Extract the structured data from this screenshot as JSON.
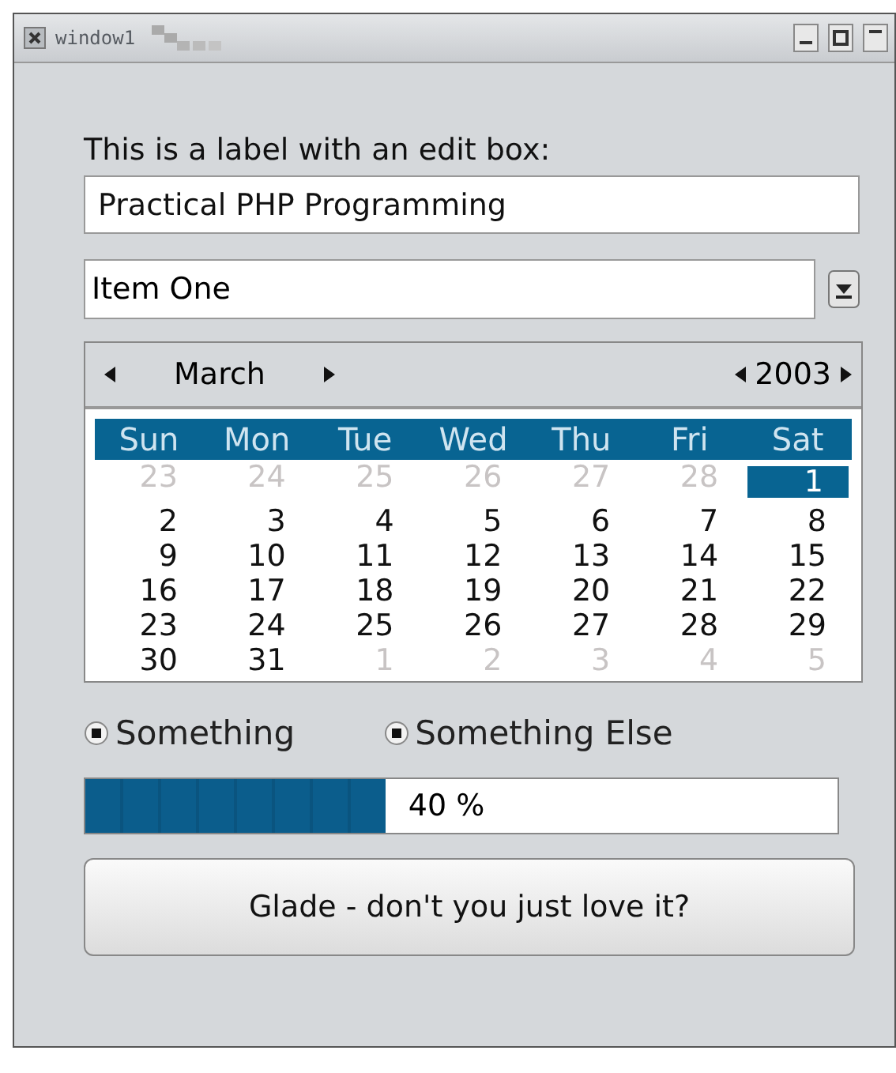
{
  "window": {
    "title": "window1"
  },
  "label": "This is a label with an edit box:",
  "entry": {
    "value": "Practical PHP Programming"
  },
  "combo": {
    "value": "Item One"
  },
  "calendar": {
    "month": "March",
    "year": "2003",
    "weekdays": [
      "Sun",
      "Mon",
      "Tue",
      "Wed",
      "Thu",
      "Fri",
      "Sat"
    ],
    "weeks": [
      [
        {
          "day": "23",
          "dim": true,
          "selected": false
        },
        {
          "day": "24",
          "dim": true,
          "selected": false
        },
        {
          "day": "25",
          "dim": true,
          "selected": false
        },
        {
          "day": "26",
          "dim": true,
          "selected": false
        },
        {
          "day": "27",
          "dim": true,
          "selected": false
        },
        {
          "day": "28",
          "dim": true,
          "selected": false
        },
        {
          "day": "1",
          "dim": false,
          "selected": true
        }
      ],
      [
        {
          "day": "2",
          "dim": false,
          "selected": false
        },
        {
          "day": "3",
          "dim": false,
          "selected": false
        },
        {
          "day": "4",
          "dim": false,
          "selected": false
        },
        {
          "day": "5",
          "dim": false,
          "selected": false
        },
        {
          "day": "6",
          "dim": false,
          "selected": false
        },
        {
          "day": "7",
          "dim": false,
          "selected": false
        },
        {
          "day": "8",
          "dim": false,
          "selected": false
        }
      ],
      [
        {
          "day": "9",
          "dim": false,
          "selected": false
        },
        {
          "day": "10",
          "dim": false,
          "selected": false
        },
        {
          "day": "11",
          "dim": false,
          "selected": false
        },
        {
          "day": "12",
          "dim": false,
          "selected": false
        },
        {
          "day": "13",
          "dim": false,
          "selected": false
        },
        {
          "day": "14",
          "dim": false,
          "selected": false
        },
        {
          "day": "15",
          "dim": false,
          "selected": false
        }
      ],
      [
        {
          "day": "16",
          "dim": false,
          "selected": false
        },
        {
          "day": "17",
          "dim": false,
          "selected": false
        },
        {
          "day": "18",
          "dim": false,
          "selected": false
        },
        {
          "day": "19",
          "dim": false,
          "selected": false
        },
        {
          "day": "20",
          "dim": false,
          "selected": false
        },
        {
          "day": "21",
          "dim": false,
          "selected": false
        },
        {
          "day": "22",
          "dim": false,
          "selected": false
        }
      ],
      [
        {
          "day": "23",
          "dim": false,
          "selected": false
        },
        {
          "day": "24",
          "dim": false,
          "selected": false
        },
        {
          "day": "25",
          "dim": false,
          "selected": false
        },
        {
          "day": "26",
          "dim": false,
          "selected": false
        },
        {
          "day": "27",
          "dim": false,
          "selected": false
        },
        {
          "day": "28",
          "dim": false,
          "selected": false
        },
        {
          "day": "29",
          "dim": false,
          "selected": false
        }
      ],
      [
        {
          "day": "30",
          "dim": false,
          "selected": false
        },
        {
          "day": "31",
          "dim": false,
          "selected": false
        },
        {
          "day": "1",
          "dim": true,
          "selected": false
        },
        {
          "day": "2",
          "dim": true,
          "selected": false
        },
        {
          "day": "3",
          "dim": true,
          "selected": false
        },
        {
          "day": "4",
          "dim": true,
          "selected": false
        },
        {
          "day": "5",
          "dim": true,
          "selected": false
        }
      ]
    ]
  },
  "radios": [
    {
      "label": "Something",
      "selected": true
    },
    {
      "label": "Something Else",
      "selected": true
    }
  ],
  "progress": {
    "level": 0.4,
    "text": "40 %"
  },
  "button": {
    "label": "Glade - don't you just love it?"
  }
}
